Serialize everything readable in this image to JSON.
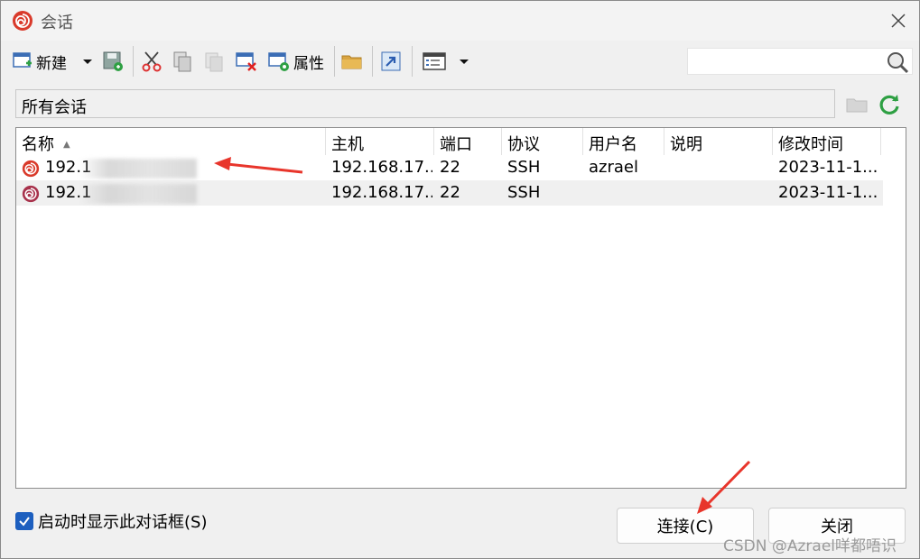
{
  "window": {
    "title": "会话",
    "app_icon": "xshell-shell-icon",
    "close_icon": "close-icon"
  },
  "toolbar": {
    "new_label": "新建",
    "properties_label": "属性",
    "search_placeholder": "",
    "icons": [
      "new-session-icon",
      "dropdown-arrow-icon",
      "save-icon",
      "cut-icon",
      "copy-icon",
      "paste-icon",
      "delete-icon",
      "properties-icon",
      "open-folder-icon",
      "shortcut-icon",
      "view-icon",
      "dropdown-arrow-icon",
      "search-icon"
    ]
  },
  "path": {
    "value": "所有会话"
  },
  "table": {
    "columns": [
      "名称",
      "主机",
      "端口",
      "协议",
      "用户名",
      "说明",
      "修改时间"
    ],
    "sorted_column": "名称",
    "rows": [
      {
        "name": "192.1",
        "host": "192.168.17...",
        "port": "22",
        "protocol": "SSH",
        "user": "azrael",
        "description": "",
        "modified": "2023-11-1...",
        "redacted": true
      },
      {
        "name": "192.1",
        "host": "192.168.17...",
        "port": "22",
        "protocol": "SSH",
        "user": "",
        "description": "",
        "modified": "2023-11-1...",
        "redacted": true
      }
    ]
  },
  "footer": {
    "show_on_startup_label": "启动时显示此对话框(S)",
    "show_on_startup_checked": true,
    "connect_label": "连接(C)",
    "close_label": "关闭"
  },
  "watermark": "CSDN @Azrael咩都唔识",
  "colors": {
    "accent": "#1d5fbf",
    "annotation_arrow": "#e8352b",
    "shell_icon": "#d93a2b"
  }
}
